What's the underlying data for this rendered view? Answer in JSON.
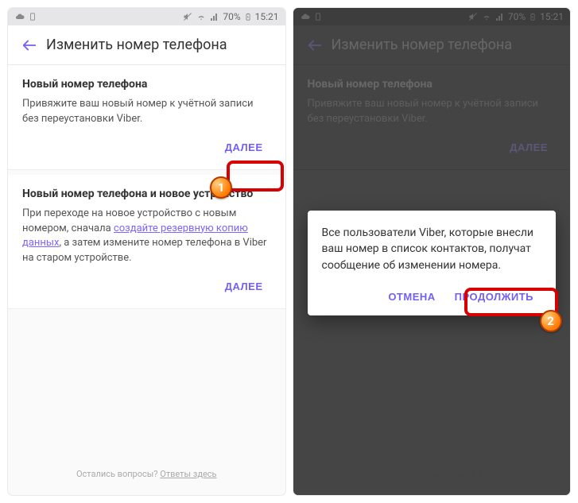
{
  "status": {
    "battery": "70%",
    "time": "15:21"
  },
  "appbar": {
    "title": "Изменить номер телефона"
  },
  "card1": {
    "title": "Новый номер телефона",
    "body": "Привяжите ваш новый номер к учётной записи без переустановки Viber.",
    "action": "ДАЛЕЕ"
  },
  "card2": {
    "title": "Новый номер телефона и новое устройство",
    "body_pre": "При переходе на новое устройство с новым номером, сначала ",
    "body_link": "создайте резервную копию данных",
    "body_post": ", а затем измените номер телефона в Viber на старом устройстве.",
    "action": "ДАЛЕЕ"
  },
  "footer": {
    "text": "Остались вопросы? ",
    "link": "Ответы здесь"
  },
  "dialog": {
    "text": "Все пользователи Viber, которые внесли ваш номер в список контактов, получат сообщение об изменении номера.",
    "cancel": "ОТМЕНА",
    "continue": "ПРОДОЛЖИТЬ"
  },
  "markers": {
    "one": "1",
    "two": "2"
  }
}
